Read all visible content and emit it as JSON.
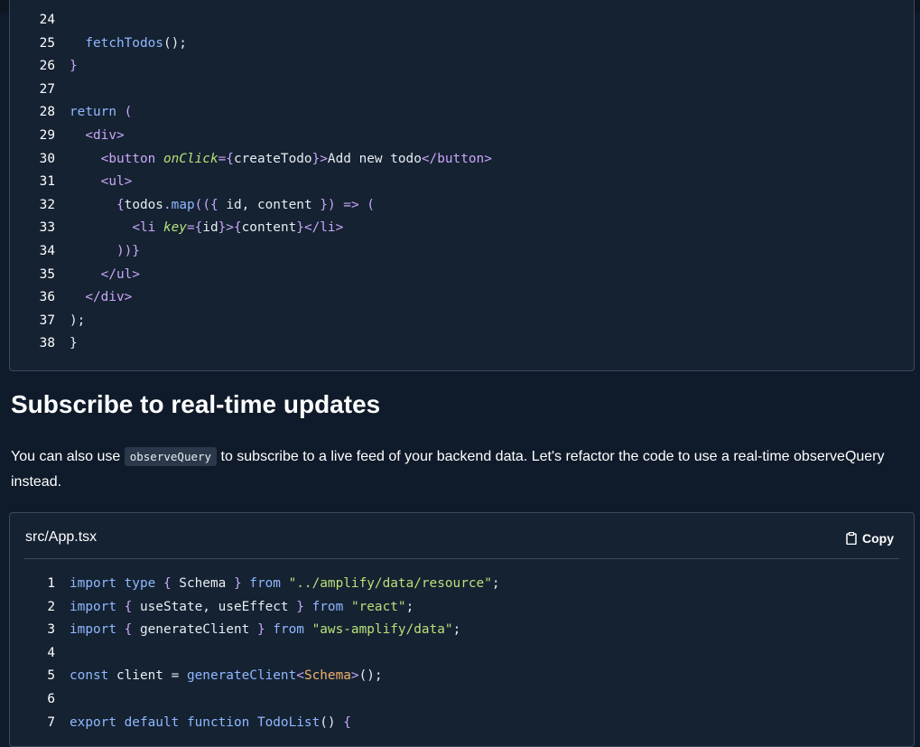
{
  "code_block_top": {
    "lines": [
      {
        "n": "24",
        "tokens": []
      },
      {
        "n": "25",
        "tokens": [
          {
            "t": "  ",
            "c": "plain"
          },
          {
            "t": "fetchTodos",
            "c": "fn"
          },
          {
            "t": "();",
            "c": "plain"
          }
        ]
      },
      {
        "n": "26",
        "tokens": [
          {
            "t": "}",
            "c": "punc"
          }
        ]
      },
      {
        "n": "27",
        "tokens": []
      },
      {
        "n": "28",
        "tokens": [
          {
            "t": "return",
            "c": "kw"
          },
          {
            "t": " (",
            "c": "punc"
          }
        ]
      },
      {
        "n": "29",
        "tokens": [
          {
            "t": "  ",
            "c": "plain"
          },
          {
            "t": "<div>",
            "c": "tag"
          }
        ]
      },
      {
        "n": "30",
        "tokens": [
          {
            "t": "    ",
            "c": "plain"
          },
          {
            "t": "<button ",
            "c": "tag"
          },
          {
            "t": "onClick",
            "c": "attr"
          },
          {
            "t": "={",
            "c": "punc"
          },
          {
            "t": "createTodo",
            "c": "plain"
          },
          {
            "t": "}>",
            "c": "punc"
          },
          {
            "t": "Add new todo",
            "c": "plain"
          },
          {
            "t": "</button>",
            "c": "tag"
          }
        ]
      },
      {
        "n": "31",
        "tokens": [
          {
            "t": "    ",
            "c": "plain"
          },
          {
            "t": "<ul>",
            "c": "tag"
          }
        ]
      },
      {
        "n": "32",
        "tokens": [
          {
            "t": "      ",
            "c": "plain"
          },
          {
            "t": "{",
            "c": "punc"
          },
          {
            "t": "todos",
            "c": "plain"
          },
          {
            "t": ".",
            "c": "punc"
          },
          {
            "t": "map",
            "c": "fn"
          },
          {
            "t": "(({ ",
            "c": "punc"
          },
          {
            "t": "id, content",
            "c": "plain"
          },
          {
            "t": " }) => (",
            "c": "punc"
          }
        ]
      },
      {
        "n": "33",
        "tokens": [
          {
            "t": "        ",
            "c": "plain"
          },
          {
            "t": "<li ",
            "c": "tag"
          },
          {
            "t": "key",
            "c": "attr"
          },
          {
            "t": "={",
            "c": "punc"
          },
          {
            "t": "id",
            "c": "plain"
          },
          {
            "t": "}>{",
            "c": "punc"
          },
          {
            "t": "content",
            "c": "plain"
          },
          {
            "t": "}</li>",
            "c": "tag"
          }
        ]
      },
      {
        "n": "34",
        "tokens": [
          {
            "t": "      ",
            "c": "plain"
          },
          {
            "t": "))}",
            "c": "punc"
          }
        ]
      },
      {
        "n": "35",
        "tokens": [
          {
            "t": "    ",
            "c": "plain"
          },
          {
            "t": "</ul>",
            "c": "tag"
          }
        ]
      },
      {
        "n": "36",
        "tokens": [
          {
            "t": "  ",
            "c": "plain"
          },
          {
            "t": "</div>",
            "c": "tag"
          }
        ]
      },
      {
        "n": "37",
        "tokens": [
          {
            "t": ");",
            "c": "plain"
          }
        ]
      },
      {
        "n": "38",
        "tokens": [
          {
            "t": "}",
            "c": "plain"
          }
        ]
      }
    ]
  },
  "section": {
    "heading": "Subscribe to real-time updates",
    "para_before": "You can also use ",
    "para_code": "observeQuery",
    "para_after": " to subscribe to a live feed of your backend data. Let's refactor the code to use a real-time observeQuery instead."
  },
  "code_block_bottom": {
    "filename": "src/App.tsx",
    "copy_label": "Copy",
    "icon": "clipboard-icon",
    "lines": [
      {
        "n": "1",
        "tokens": [
          {
            "t": "import type ",
            "c": "kw"
          },
          {
            "t": "{ ",
            "c": "punc"
          },
          {
            "t": "Schema",
            "c": "plain"
          },
          {
            "t": " } ",
            "c": "punc"
          },
          {
            "t": "from ",
            "c": "kw"
          },
          {
            "t": "\"../amplify/data/resource\"",
            "c": "str"
          },
          {
            "t": ";",
            "c": "plain"
          }
        ]
      },
      {
        "n": "2",
        "tokens": [
          {
            "t": "import ",
            "c": "kw"
          },
          {
            "t": "{ ",
            "c": "punc"
          },
          {
            "t": "useState, useEffect",
            "c": "plain"
          },
          {
            "t": " } ",
            "c": "punc"
          },
          {
            "t": "from ",
            "c": "kw"
          },
          {
            "t": "\"react\"",
            "c": "str"
          },
          {
            "t": ";",
            "c": "plain"
          }
        ]
      },
      {
        "n": "3",
        "tokens": [
          {
            "t": "import ",
            "c": "kw"
          },
          {
            "t": "{ ",
            "c": "punc"
          },
          {
            "t": "generateClient",
            "c": "plain"
          },
          {
            "t": " } ",
            "c": "punc"
          },
          {
            "t": "from ",
            "c": "kw"
          },
          {
            "t": "\"aws-amplify/data\"",
            "c": "str"
          },
          {
            "t": ";",
            "c": "plain"
          }
        ]
      },
      {
        "n": "4",
        "tokens": []
      },
      {
        "n": "5",
        "tokens": [
          {
            "t": "const ",
            "c": "kw"
          },
          {
            "t": "client = ",
            "c": "plain"
          },
          {
            "t": "generateClient",
            "c": "fn"
          },
          {
            "t": "<",
            "c": "punc"
          },
          {
            "t": "Schema",
            "c": "type"
          },
          {
            "t": ">",
            "c": "punc"
          },
          {
            "t": "();",
            "c": "plain"
          }
        ]
      },
      {
        "n": "6",
        "tokens": []
      },
      {
        "n": "7",
        "tokens": [
          {
            "t": "export default function ",
            "c": "kw"
          },
          {
            "t": "TodoList",
            "c": "fn"
          },
          {
            "t": "() ",
            "c": "plain"
          },
          {
            "t": "{",
            "c": "punc"
          }
        ]
      }
    ]
  }
}
